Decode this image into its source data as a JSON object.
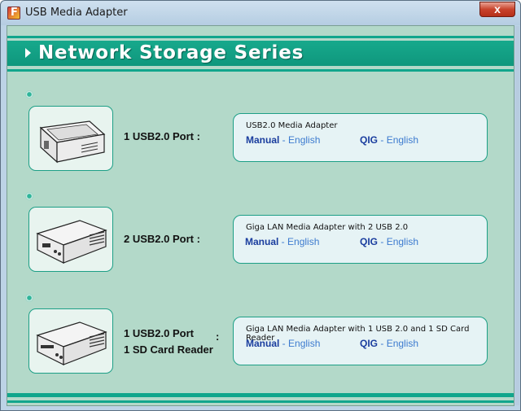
{
  "window": {
    "title": "USB Media Adapter",
    "close_label": "x"
  },
  "header": {
    "title": "Network Storage Series"
  },
  "products": [
    {
      "port_lines": [
        "1 USB2.0 Port :"
      ],
      "title": "USB2.0 Media Adapter",
      "manual": {
        "label": "Manual",
        "sep": " - ",
        "lang": "English"
      },
      "qig": {
        "label": "QIG",
        "sep": " - ",
        "lang": "English"
      }
    },
    {
      "port_lines": [
        "2 USB2.0 Port :"
      ],
      "title": "Giga LAN Media Adapter with 2 USB 2.0",
      "manual": {
        "label": "Manual",
        "sep": " - ",
        "lang": "English"
      },
      "qig": {
        "label": "QIG",
        "sep": " - ",
        "lang": "English"
      }
    },
    {
      "port_lines": [
        "1 USB2.0 Port",
        "1 SD Card Reader"
      ],
      "colon": ":",
      "title": "Giga LAN Media Adapter with 1 USB 2.0 and 1 SD Card Reader",
      "manual": {
        "label": "Manual",
        "sep": " - ",
        "lang": "English"
      },
      "qig": {
        "label": "QIG",
        "sep": " - ",
        "lang": "English"
      }
    }
  ],
  "colors": {
    "teal": "#11a68c",
    "background": "#b3d9c9",
    "link_dark": "#1a3d9e",
    "link_light": "#3d7bcf"
  }
}
